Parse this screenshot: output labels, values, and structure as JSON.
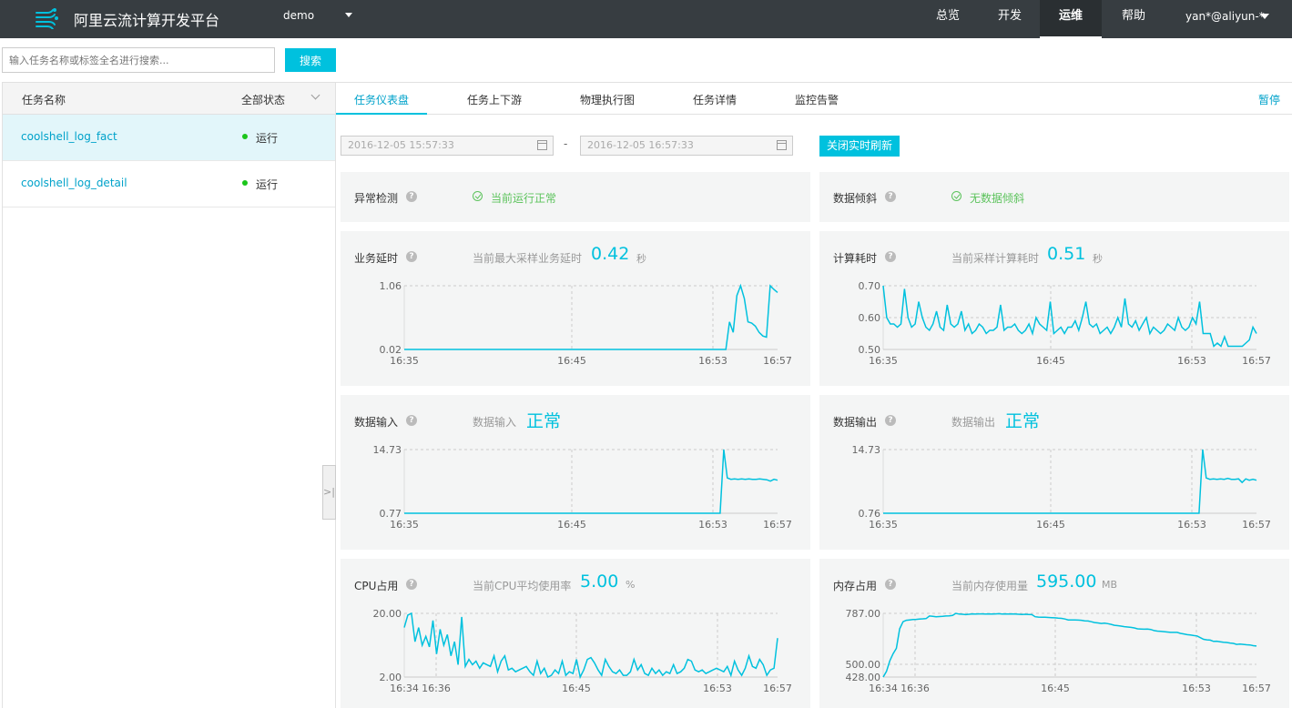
{
  "header": {
    "brand": "阿里云流计算开发平台",
    "project": "demo",
    "nav": [
      "总览",
      "开发",
      "运维",
      "帮助"
    ],
    "active_nav": "运维",
    "user": "yan*@aliyun-*"
  },
  "search": {
    "placeholder": "输入任务名称或标签全名进行搜索...",
    "button": "搜索"
  },
  "sidebar": {
    "col_name": "任务名称",
    "col_status": "全部状态",
    "tasks": [
      {
        "name": "coolshell_log_fact",
        "status": "运行"
      },
      {
        "name": "coolshell_log_detail",
        "status": "运行"
      }
    ]
  },
  "tabs": [
    "任务仪表盘",
    "任务上下游",
    "物理执行图",
    "任务详情",
    "监控告警"
  ],
  "pause": "暂停",
  "dates": {
    "start": "2016-12-05 15:57:33",
    "separator": "-",
    "end": "2016-12-05 16:57:33"
  },
  "refresh_button": "关闭实时刷新",
  "colors": {
    "accent": "#00c1de",
    "ok": "#5cc35c",
    "topbar": "#373d41"
  },
  "status_panels": [
    {
      "title": "异常检测",
      "status": "当前运行正常"
    },
    {
      "title": "数据倾斜",
      "status": "无数据倾斜"
    }
  ],
  "chart_panels": [
    {
      "title": "业务延时",
      "sub": "当前最大采样业务延时",
      "value": "0.42",
      "unit": "秒"
    },
    {
      "title": "计算耗时",
      "sub": "当前采样计算耗时",
      "value": "0.51",
      "unit": "秒"
    },
    {
      "title": "数据输入",
      "sub": "数据输入",
      "value": "正常",
      "unit": ""
    },
    {
      "title": "数据输出",
      "sub": "数据输出",
      "value": "正常",
      "unit": ""
    },
    {
      "title": "CPU占用",
      "sub": "当前CPU平均使用率",
      "value": "5.00",
      "unit": "%"
    },
    {
      "title": "内存占用",
      "sub": "当前内存使用量",
      "value": "595.00",
      "unit": "MB"
    }
  ],
  "chart_data": [
    {
      "type": "line",
      "name": "biz-latency",
      "xticks": [
        "16:35",
        "16:45",
        "16:53",
        "16:57"
      ],
      "yticks": [
        "1.06",
        "0.02"
      ],
      "ylim": [
        0.02,
        1.06
      ],
      "values": [
        0.02,
        0.02,
        0.02,
        0.02,
        0.02,
        0.02,
        0.02,
        0.02,
        0.02,
        0.02,
        0.02,
        0.02,
        0.02,
        0.02,
        0.02,
        0.02,
        0.02,
        0.02,
        0.02,
        0.02,
        0.02,
        0.02,
        0.02,
        0.02,
        0.02,
        0.02,
        0.02,
        0.02,
        0.02,
        0.02,
        0.02,
        0.02,
        0.02,
        0.02,
        0.02,
        0.02,
        0.02,
        0.02,
        0.02,
        0.02,
        0.02,
        0.02,
        0.02,
        0.02,
        0.02,
        0.02,
        0.02,
        0.02,
        0.02,
        0.02,
        0.02,
        0.02,
        0.02,
        0.02,
        0.02,
        0.02,
        0.02,
        0.02,
        0.02,
        0.02,
        0.02,
        0.02,
        0.02,
        0.02,
        0.02,
        0.02,
        0.02,
        0.02,
        0.02,
        0.02,
        0.02,
        0.02,
        0.02,
        0.02,
        0.02,
        0.02,
        0.02,
        0.02,
        0.02,
        0.02,
        0.02,
        0.02,
        0.02,
        0.02,
        0.02,
        0.02,
        0.02,
        0.02,
        0.47,
        0.3,
        0.9,
        1.06,
        0.85,
        0.47,
        0.45,
        0.4,
        0.3,
        0.24,
        0.22,
        1.06,
        1.0,
        0.95
      ]
    },
    {
      "type": "line",
      "name": "compute-time",
      "xticks": [
        "16:35",
        "16:45",
        "16:53",
        "16:57"
      ],
      "yticks": [
        "0.70",
        "0.60",
        "0.50"
      ],
      "ylim": [
        0.5,
        0.7
      ],
      "values": [
        0.7,
        0.6,
        0.58,
        0.58,
        0.57,
        0.58,
        0.69,
        0.6,
        0.57,
        0.58,
        0.65,
        0.6,
        0.57,
        0.56,
        0.58,
        0.62,
        0.57,
        0.56,
        0.64,
        0.58,
        0.57,
        0.58,
        0.62,
        0.56,
        0.58,
        0.55,
        0.56,
        0.58,
        0.57,
        0.55,
        0.56,
        0.56,
        0.57,
        0.64,
        0.56,
        0.57,
        0.57,
        0.58,
        0.56,
        0.55,
        0.56,
        0.58,
        0.55,
        0.6,
        0.58,
        0.57,
        0.56,
        0.65,
        0.55,
        0.56,
        0.57,
        0.55,
        0.57,
        0.57,
        0.59,
        0.56,
        0.6,
        0.65,
        0.58,
        0.57,
        0.58,
        0.55,
        0.56,
        0.57,
        0.55,
        0.57,
        0.6,
        0.57,
        0.66,
        0.58,
        0.57,
        0.59,
        0.56,
        0.58,
        0.6,
        0.55,
        0.57,
        0.56,
        0.55,
        0.56,
        0.58,
        0.57,
        0.56,
        0.6,
        0.57,
        0.56,
        0.57,
        0.6,
        0.58,
        0.65,
        0.55,
        0.55,
        0.55,
        0.51,
        0.52,
        0.51,
        0.54,
        0.51,
        0.51,
        0.51,
        0.51,
        0.51,
        0.52,
        0.53,
        0.57,
        0.55
      ]
    },
    {
      "type": "line",
      "name": "data-input",
      "xticks": [
        "16:35",
        "16:45",
        "16:53",
        "16:57"
      ],
      "yticks": [
        "14.73",
        "0.77"
      ],
      "ylim": [
        0.77,
        14.73
      ],
      "values": [
        0.77,
        0.77,
        0.77,
        0.77,
        0.77,
        0.77,
        0.77,
        0.77,
        0.77,
        0.77,
        0.77,
        0.77,
        0.77,
        0.77,
        0.77,
        0.77,
        0.77,
        0.77,
        0.77,
        0.77,
        0.77,
        0.77,
        0.77,
        0.77,
        0.77,
        0.77,
        0.77,
        0.77,
        0.77,
        0.77,
        0.77,
        0.77,
        0.77,
        0.77,
        0.77,
        0.77,
        0.77,
        0.77,
        0.77,
        0.77,
        0.77,
        0.77,
        0.77,
        0.77,
        0.77,
        0.77,
        0.77,
        0.77,
        0.77,
        0.77,
        0.77,
        0.77,
        0.77,
        0.77,
        0.77,
        0.77,
        0.77,
        0.77,
        0.77,
        0.77,
        0.77,
        0.77,
        0.77,
        0.77,
        0.77,
        0.77,
        0.77,
        0.77,
        0.77,
        0.77,
        0.77,
        0.77,
        0.77,
        0.77,
        0.77,
        0.77,
        0.77,
        0.77,
        0.77,
        0.77,
        0.77,
        0.77,
        0.77,
        0.77,
        0.77,
        0.77,
        0.77,
        0.77,
        0.77,
        14.73,
        8.5,
        8.2,
        8.3,
        8.2,
        8.3,
        8.2,
        8.3,
        8.2,
        8.2,
        8.3,
        8.2,
        8.1,
        7.8,
        8.2,
        8.0
      ]
    },
    {
      "type": "line",
      "name": "data-output",
      "xticks": [
        "16:35",
        "16:45",
        "16:53",
        "16:57"
      ],
      "yticks": [
        "14.73",
        "0.76"
      ],
      "ylim": [
        0.76,
        14.73
      ],
      "values": [
        0.76,
        0.76,
        0.76,
        0.76,
        0.76,
        0.76,
        0.76,
        0.76,
        0.76,
        0.76,
        0.76,
        0.76,
        0.76,
        0.76,
        0.76,
        0.76,
        0.76,
        0.76,
        0.76,
        0.76,
        0.76,
        0.76,
        0.76,
        0.76,
        0.76,
        0.76,
        0.76,
        0.76,
        0.76,
        0.76,
        0.76,
        0.76,
        0.76,
        0.76,
        0.76,
        0.76,
        0.76,
        0.76,
        0.76,
        0.76,
        0.76,
        0.76,
        0.76,
        0.76,
        0.76,
        0.76,
        0.76,
        0.76,
        0.76,
        0.76,
        0.76,
        0.76,
        0.76,
        0.76,
        0.76,
        0.76,
        0.76,
        0.76,
        0.76,
        0.76,
        0.76,
        0.76,
        0.76,
        0.76,
        0.76,
        0.76,
        0.76,
        0.76,
        0.76,
        0.76,
        0.76,
        0.76,
        0.76,
        0.76,
        0.76,
        0.76,
        0.76,
        0.76,
        0.76,
        0.76,
        0.76,
        0.76,
        0.76,
        0.76,
        0.76,
        0.76,
        0.76,
        0.76,
        0.76,
        14.73,
        8.5,
        8.2,
        8.3,
        8.2,
        8.3,
        8.2,
        8.4,
        8.2,
        8.2,
        8.3,
        7.5,
        8.3,
        8.0,
        8.2,
        8.0
      ]
    },
    {
      "type": "line",
      "name": "cpu-usage",
      "xticks": [
        "16:34",
        "16:36",
        "16:45",
        "16:53",
        "16:57"
      ],
      "yticks": [
        "20.00",
        "2.00"
      ],
      "ylim": [
        2,
        20
      ],
      "values": [
        16,
        19.5,
        20.5,
        12,
        16,
        11,
        13.5,
        10.5,
        18,
        8.5,
        15.5,
        11,
        14,
        8,
        12,
        5.5,
        19,
        5,
        7,
        5.5,
        6.5,
        4.5,
        6,
        5.5,
        5,
        8,
        3.5,
        6.5,
        8,
        4,
        4.5,
        3.5,
        4,
        4.5,
        5,
        3.5,
        2.5,
        6.5,
        3,
        4.5,
        2,
        2.5,
        4,
        3,
        6.5,
        2.5,
        3.5,
        3,
        7,
        2,
        4,
        7,
        7.5,
        6,
        4,
        2.5,
        7,
        5,
        3.5,
        3,
        4,
        2.5,
        2.5,
        3.5,
        7,
        4,
        5.5,
        3,
        2.5,
        4.5,
        3,
        4,
        2.5,
        3.5,
        3,
        5.5,
        3,
        3.5,
        4.5,
        7,
        6.5,
        4,
        3.5,
        4,
        3,
        3.5,
        4,
        4.5,
        4,
        3.5,
        5,
        2.5,
        6.5,
        4,
        2.5,
        4.5,
        8,
        5,
        4.5,
        7,
        5.5,
        2.5,
        4,
        4.5,
        13
      ]
    },
    {
      "type": "line",
      "name": "memory-usage",
      "xticks": [
        "16:34",
        "16:36",
        "16:45",
        "16:53",
        "16:57"
      ],
      "yticks": [
        "787.00",
        "500.00",
        "428.00"
      ],
      "ylim": [
        428,
        787
      ],
      "values": [
        428,
        460,
        520,
        560,
        590,
        700,
        740,
        748,
        750,
        752,
        753,
        755,
        756,
        758,
        772,
        770,
        768,
        769,
        770,
        772,
        773,
        775,
        788,
        783,
        782,
        780,
        782,
        784,
        783,
        784,
        784,
        783,
        784,
        783,
        784,
        785,
        783,
        784,
        783,
        784,
        783,
        782,
        781,
        782,
        781,
        780,
        768,
        766,
        765,
        765,
        764,
        763,
        762,
        760,
        759,
        755,
        750,
        750,
        750,
        749,
        748,
        745,
        744,
        740,
        735,
        733,
        730,
        732,
        729,
        725,
        720,
        718,
        715,
        712,
        710,
        708,
        705,
        700,
        699,
        698,
        699,
        696,
        690,
        687,
        686,
        684,
        682,
        680,
        680,
        680,
        674,
        671,
        667,
        665,
        662,
        660,
        650,
        641,
        638,
        636,
        629,
        630,
        627,
        624,
        623,
        620,
        618,
        612,
        614,
        612,
        610,
        609,
        605,
        603
      ]
    }
  ]
}
